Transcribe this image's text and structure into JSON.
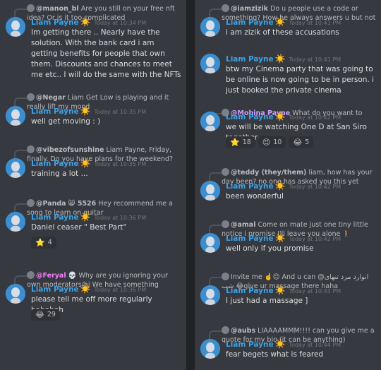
{
  "author": {
    "name": "Liam Payne",
    "badge": "☀️"
  },
  "left": [
    {
      "reply_user": "@manon_bl",
      "reply_text": "Are you still on your free nft idea? Or is it too complicated",
      "time": "Today at 10:34 PM",
      "text": "Im getting there .. Nearly have the solution. With the bank card i am getting benefits for people that own them. Discounts and chances to meet me etc.. I will do the same with the NFTs",
      "reactions": []
    },
    {
      "reply_user": "@Negar",
      "reply_text": "Liam Get Low is playing and it really lift my mood",
      "time": "Today at 10:35 PM",
      "text": "well get moving : )",
      "reactions": []
    },
    {
      "reply_user": "@vibezofsunshine",
      "reply_text": "Liam Payne, Friday, finally. Do you have  plans for the weekend? share them with ...",
      "time": "Today at 10:35 PM",
      "text": "training a lot ...",
      "reactions": []
    },
    {
      "reply_user": "@Panda",
      "reply_extra": "😸 5526",
      "reply_text": "Hey recommend me a song to learn on guitar",
      "time": "Today at 10:36 PM",
      "text": "Daniel ceaser \" Best Part\"",
      "reactions": [
        {
          "emoji": "⭐",
          "count": "4"
        }
      ]
    },
    {
      "reply_user": "@Feryal",
      "reply_extra": "💀",
      "reply_text": "Why are you ignoring your own moderators/hj We have something important to ...",
      "time": "Today at 10:36 PM",
      "text": "please tell me off more regularly hahahah",
      "reactions": [
        {
          "emoji": "😂",
          "count": "29"
        }
      ]
    }
  ],
  "right": [
    {
      "reply_user": "@iamzizik",
      "reply_text": "Do u people use a code or something? How he always answers u but not me...",
      "time": "Today at 10:41 PM",
      "text": "i am zizik of these accusations",
      "reactions": []
    },
    {
      "reply_user": "",
      "reply_text": "",
      "time": "Today at 10:41 PM",
      "text": "btw my Cinema party that was going to be online is now going to be in person. i just booked the private cinema",
      "reactions": []
    },
    {
      "reply_user": "@Mobina Payne",
      "reply_text": "What do you want to watch?",
      "time": "Today at 10:42 PM",
      "text": "we will be watching One D at San Siro together",
      "reactions": [
        {
          "emoji": "⭐",
          "count": "18"
        },
        {
          "emoji": "😍",
          "count": "10"
        },
        {
          "emoji": "😂",
          "count": "5"
        }
      ]
    },
    {
      "reply_user": "@teddy (they/them)",
      "reply_text": "liam, how has your day been? no one has asked you this yet",
      "time": "Today at 10:42 PM",
      "text": "been wonderful",
      "reactions": []
    },
    {
      "reply_user": "@amal",
      "reply_text": "Come on mate just one tiny little notice i promise I'll leave you alone 🚶",
      "time": "Today at 10:42 PM",
      "text": "well only if you promise",
      "reactions": []
    },
    {
      "reply_user": "",
      "reply_text": "Invite me ☝️😌 And u can @انوارد مرد تنهای شب 😂give ur massage there haha",
      "time": "Today at 10:43 PM",
      "text": "I just had a massage ]",
      "reactions": []
    },
    {
      "reply_user": "@aubs",
      "reply_text": "LIAAAAMMM!!!! can you give me a quote for my bio (it can be anything)",
      "time": "Today at 10:44 PM",
      "text": "fear begets what is feared",
      "reactions": []
    }
  ]
}
